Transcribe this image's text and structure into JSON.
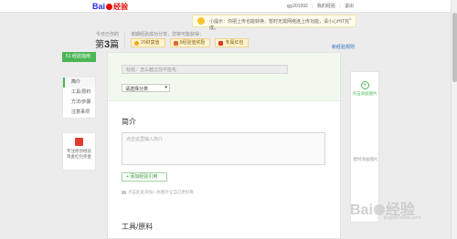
{
  "header": {
    "logo_text_1": "Bai",
    "logo_text_2": "经验",
    "username": "qjy201992",
    "my_exp_link": "我的经验",
    "logout_link": "退出",
    "sep": "|"
  },
  "notice": {
    "text": "小提示：你把上传也能转换，暂时无需网络连上传功能，请小心HIT完成。"
  },
  "stats": {
    "label": "今日已作的",
    "prefix": "第",
    "count": "3",
    "suffix": "篇"
  },
  "rewards": {
    "title": "该期经验成功分享，您将可能获得：",
    "items": [
      {
        "label": "20财富值",
        "icon": "coin-icon"
      },
      {
        "label": "5经验值奖励",
        "icon": "badge-icon"
      },
      {
        "label": "专属红包",
        "icon": "gift-icon"
      }
    ],
    "rules_link": "新经验规则"
  },
  "sidebar": {
    "header": "51 经验指南",
    "items": [
      {
        "label": "简介",
        "active": true
      },
      {
        "label": "工具/原料",
        "active": false
      },
      {
        "label": "方法/步骤",
        "active": false
      },
      {
        "label": "注意事项",
        "active": false
      }
    ],
    "ad_line1": "专注原创经验",
    "ad_line2": "现金红包奖金"
  },
  "editor": {
    "title_placeholder": "标题：怎么越过前不能毛",
    "category_value": "请选择分类",
    "category_arrow": "▾",
    "intro_heading": "简介",
    "intro_placeholder": "点击这里输入简介",
    "add_step_label": "+ 添加经验引用",
    "upload_hint": "点击此处添加一张图片让自己更好看",
    "tools_heading": "工具/原料"
  },
  "right_panel": {
    "plus": "+",
    "add_label": "点击添加图片",
    "tip": "暂时添加图片"
  },
  "watermark": {
    "text_1": "Bai",
    "text_2": "经验",
    "url": "jingyan.baidu.com"
  }
}
